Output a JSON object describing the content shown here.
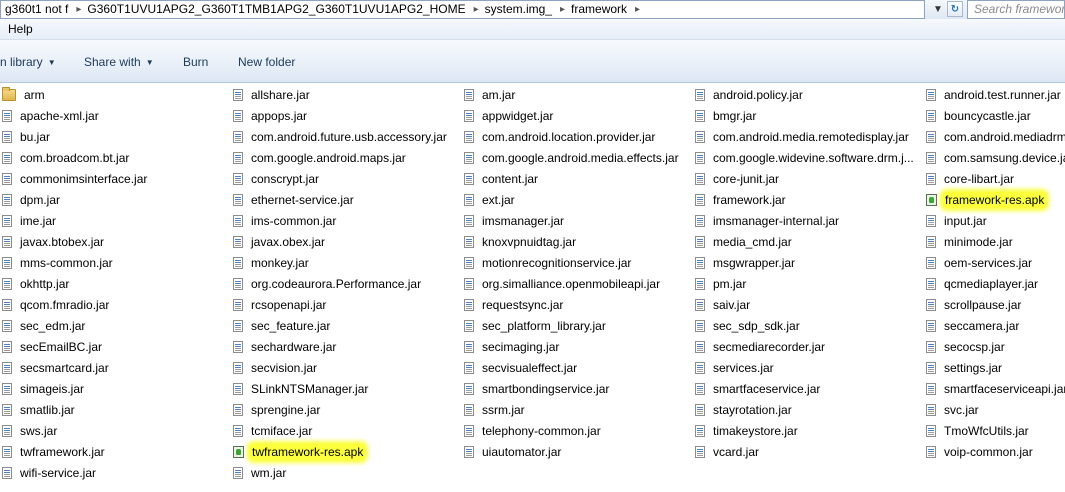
{
  "address_bar": {
    "crumbs": [
      "g360t1 not f",
      "G360T1UVU1APG2_G360T1TMB1APG2_G360T1UVU1APG2_HOME",
      "system.img_",
      "framework"
    ],
    "search_placeholder": "Search framework"
  },
  "menu": {
    "items": [
      "Help"
    ]
  },
  "toolbar": {
    "include_in_library": "n library",
    "share_with": "Share with",
    "burn": "Burn",
    "new_folder": "New folder"
  },
  "files": {
    "columns": [
      [
        {
          "name": "arm",
          "type": "folder"
        },
        {
          "name": "apache-xml.jar",
          "type": "jar"
        },
        {
          "name": "bu.jar",
          "type": "jar"
        },
        {
          "name": "com.broadcom.bt.jar",
          "type": "jar"
        },
        {
          "name": "commonimsinterface.jar",
          "type": "jar"
        },
        {
          "name": "dpm.jar",
          "type": "jar"
        },
        {
          "name": "ime.jar",
          "type": "jar"
        },
        {
          "name": "javax.btobex.jar",
          "type": "jar"
        },
        {
          "name": "mms-common.jar",
          "type": "jar"
        },
        {
          "name": "okhttp.jar",
          "type": "jar"
        },
        {
          "name": "qcom.fmradio.jar",
          "type": "jar"
        },
        {
          "name": "sec_edm.jar",
          "type": "jar"
        },
        {
          "name": "secEmailBC.jar",
          "type": "jar"
        },
        {
          "name": "secsmartcard.jar",
          "type": "jar"
        },
        {
          "name": "simageis.jar",
          "type": "jar"
        },
        {
          "name": "smatlib.jar",
          "type": "jar"
        },
        {
          "name": "sws.jar",
          "type": "jar"
        },
        {
          "name": "twframework.jar",
          "type": "jar"
        },
        {
          "name": "wifi-service.jar",
          "type": "jar"
        }
      ],
      [
        {
          "name": "allshare.jar",
          "type": "jar"
        },
        {
          "name": "appops.jar",
          "type": "jar"
        },
        {
          "name": "com.android.future.usb.accessory.jar",
          "type": "jar"
        },
        {
          "name": "com.google.android.maps.jar",
          "type": "jar"
        },
        {
          "name": "conscrypt.jar",
          "type": "jar"
        },
        {
          "name": "ethernet-service.jar",
          "type": "jar"
        },
        {
          "name": "ims-common.jar",
          "type": "jar"
        },
        {
          "name": "javax.obex.jar",
          "type": "jar"
        },
        {
          "name": "monkey.jar",
          "type": "jar"
        },
        {
          "name": "org.codeaurora.Performance.jar",
          "type": "jar"
        },
        {
          "name": "rcsopenapi.jar",
          "type": "jar"
        },
        {
          "name": "sec_feature.jar",
          "type": "jar"
        },
        {
          "name": "sechardware.jar",
          "type": "jar"
        },
        {
          "name": "secvision.jar",
          "type": "jar"
        },
        {
          "name": "SLinkNTSManager.jar",
          "type": "jar"
        },
        {
          "name": "sprengine.jar",
          "type": "jar"
        },
        {
          "name": "tcmiface.jar",
          "type": "jar"
        },
        {
          "name": "twframework-res.apk",
          "type": "apk",
          "highlight": true
        },
        {
          "name": "wm.jar",
          "type": "jar"
        }
      ],
      [
        {
          "name": "am.jar",
          "type": "jar"
        },
        {
          "name": "appwidget.jar",
          "type": "jar"
        },
        {
          "name": "com.android.location.provider.jar",
          "type": "jar"
        },
        {
          "name": "com.google.android.media.effects.jar",
          "type": "jar"
        },
        {
          "name": "content.jar",
          "type": "jar"
        },
        {
          "name": "ext.jar",
          "type": "jar"
        },
        {
          "name": "imsmanager.jar",
          "type": "jar"
        },
        {
          "name": "knoxvpnuidtag.jar",
          "type": "jar"
        },
        {
          "name": "motionrecognitionservice.jar",
          "type": "jar"
        },
        {
          "name": "org.simalliance.openmobileapi.jar",
          "type": "jar"
        },
        {
          "name": "requestsync.jar",
          "type": "jar"
        },
        {
          "name": "sec_platform_library.jar",
          "type": "jar"
        },
        {
          "name": "secimaging.jar",
          "type": "jar"
        },
        {
          "name": "secvisualeffect.jar",
          "type": "jar"
        },
        {
          "name": "smartbondingservice.jar",
          "type": "jar"
        },
        {
          "name": "ssrm.jar",
          "type": "jar"
        },
        {
          "name": "telephony-common.jar",
          "type": "jar"
        },
        {
          "name": "uiautomator.jar",
          "type": "jar"
        }
      ],
      [
        {
          "name": "android.policy.jar",
          "type": "jar"
        },
        {
          "name": "bmgr.jar",
          "type": "jar"
        },
        {
          "name": "com.android.media.remotedisplay.jar",
          "type": "jar"
        },
        {
          "name": "com.google.widevine.software.drm.j...",
          "type": "jar"
        },
        {
          "name": "core-junit.jar",
          "type": "jar"
        },
        {
          "name": "framework.jar",
          "type": "jar"
        },
        {
          "name": "imsmanager-internal.jar",
          "type": "jar"
        },
        {
          "name": "media_cmd.jar",
          "type": "jar"
        },
        {
          "name": "msgwrapper.jar",
          "type": "jar"
        },
        {
          "name": "pm.jar",
          "type": "jar"
        },
        {
          "name": "saiv.jar",
          "type": "jar"
        },
        {
          "name": "sec_sdp_sdk.jar",
          "type": "jar"
        },
        {
          "name": "secmediarecorder.jar",
          "type": "jar"
        },
        {
          "name": "services.jar",
          "type": "jar"
        },
        {
          "name": "smartfaceservice.jar",
          "type": "jar"
        },
        {
          "name": "stayrotation.jar",
          "type": "jar"
        },
        {
          "name": "timakeystore.jar",
          "type": "jar"
        },
        {
          "name": "vcard.jar",
          "type": "jar"
        }
      ],
      [
        {
          "name": "android.test.runner.jar",
          "type": "jar"
        },
        {
          "name": "bouncycastle.jar",
          "type": "jar"
        },
        {
          "name": "com.android.mediadrm",
          "type": "jar"
        },
        {
          "name": "com.samsung.device.ja",
          "type": "jar"
        },
        {
          "name": "core-libart.jar",
          "type": "jar"
        },
        {
          "name": "framework-res.apk",
          "type": "apk",
          "highlight": true
        },
        {
          "name": "input.jar",
          "type": "jar"
        },
        {
          "name": "minimode.jar",
          "type": "jar"
        },
        {
          "name": "oem-services.jar",
          "type": "jar"
        },
        {
          "name": "qcmediaplayer.jar",
          "type": "jar"
        },
        {
          "name": "scrollpause.jar",
          "type": "jar"
        },
        {
          "name": "seccamera.jar",
          "type": "jar"
        },
        {
          "name": "secocsp.jar",
          "type": "jar"
        },
        {
          "name": "settings.jar",
          "type": "jar"
        },
        {
          "name": "smartfaceserviceapi.jar",
          "type": "jar"
        },
        {
          "name": "svc.jar",
          "type": "jar"
        },
        {
          "name": "TmoWfcUtils.jar",
          "type": "jar"
        },
        {
          "name": "voip-common.jar",
          "type": "jar"
        }
      ]
    ]
  }
}
